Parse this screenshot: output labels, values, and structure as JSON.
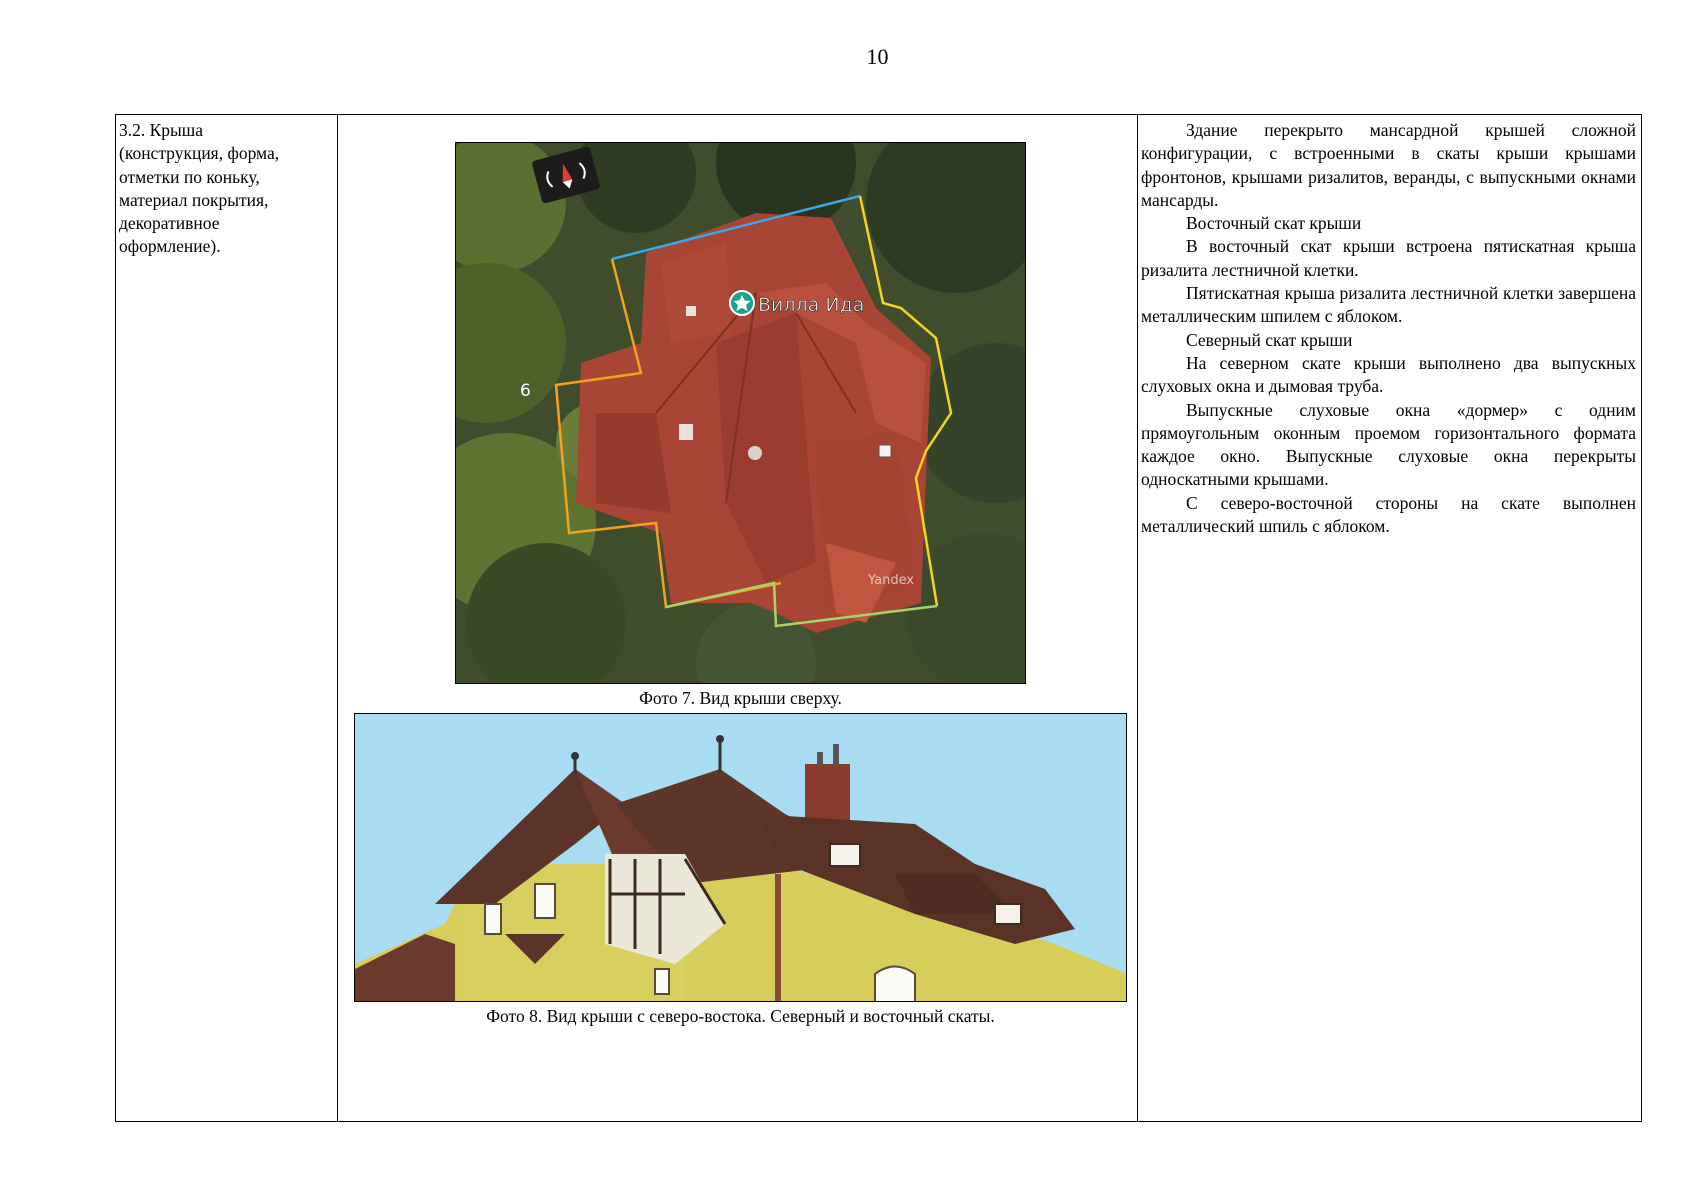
{
  "page_number": "10",
  "section": {
    "label_lines": [
      "3.2. Крыша",
      "(конструкция, форма,",
      "отметки по коньку,",
      "материал покрытия,",
      "декоративное",
      "оформление)."
    ]
  },
  "photo7": {
    "map_label": "Вилла Ида",
    "marker_number": "6",
    "watermark": "Yandex",
    "caption": "Фото 7. Вид крыши сверху."
  },
  "photo8": {
    "caption": "Фото 8. Вид крыши с северо-востока. Северный и восточный скаты."
  },
  "description": {
    "paragraphs": [
      "Здание перекрыто мансардной крышей сложной конфигурации, с встроенными в скаты крыши крышами фронтонов, крышами ризалитов, веранды, с выпускными окнами мансарды.",
      "Восточный скат крыши",
      "В восточный скат крыши встроена пятискатная крыша ризалита лестничной клетки.",
      "Пятискатная крыша ризалита лестничной клетки завершена металлическим шпилем с яблоком.",
      "Северный скат крыши",
      "На северном скате крыши выполнено два выпускных слуховых окна и дымовая труба.",
      "Выпускные слуховые окна «дормер» с одним прямоугольным оконным проемом горизонтального формата каждое окно. Выпускные слуховые окна перекрыты односкатными крышами.",
      "С северо-восточной стороны на  скате выполнен металлический шпиль с яблоком."
    ]
  }
}
